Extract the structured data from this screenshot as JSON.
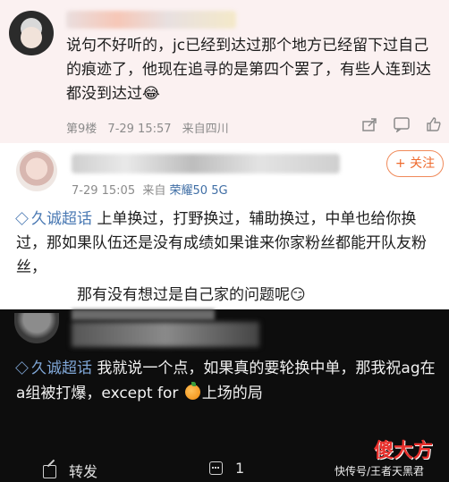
{
  "reply": {
    "text": "说句不好听的，jc已经到达过那个地方已经留下过自己的痕迹了，他现在追寻的是第四个罢了，有些人连到达都没到达过",
    "emoji": "😂",
    "floor": "第9楼",
    "time": "7-29 15:57",
    "location": "来自四川"
  },
  "post": {
    "follow_label": "+ 关注",
    "time": "7-29 15:05",
    "from": "来自",
    "device": "荣耀50 5G",
    "topic": "久诚超话",
    "text": "上单换过，打野换过，辅助换过，中单也给你换过，那如果队伍还是没有成绩如果谁来你家粉丝都能开队友粉丝，",
    "text2": "那有没有想过是自己家的问题呢",
    "emoji2": "😏"
  },
  "comment": {
    "topic": "久诚超话",
    "text_a": "我就说一个点，如果真的要轮换中单，那我祝ag在a组被打爆，except for",
    "text_b": "上场的局",
    "repost_label": "转发",
    "comment_count": "1"
  },
  "watermark": {
    "logo": "傻大方",
    "caption": "快传号/王者天黑君"
  },
  "icons": {
    "reply_actions": [
      "share-icon",
      "comment-icon",
      "like-icon"
    ],
    "topic": "diamond-icon",
    "footer": [
      "repost-icon",
      "comment-icon"
    ]
  }
}
